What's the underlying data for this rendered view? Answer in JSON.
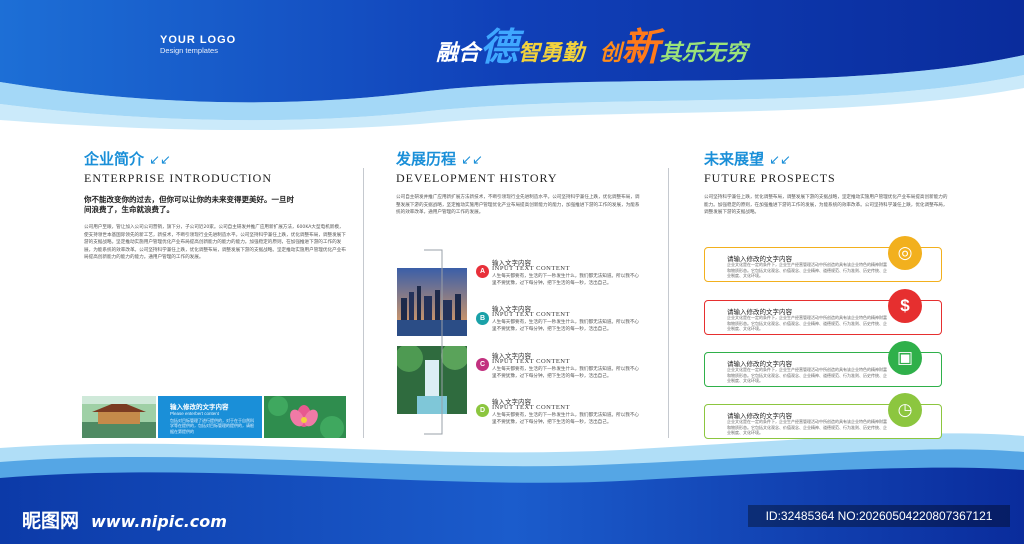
{
  "logo": {
    "line1": "YOUR LOGO",
    "line2": "Design templates"
  },
  "slogan": {
    "p1": "融合",
    "p2": "德",
    "p3": "智勇勤",
    "p4": "创",
    "p5": "新",
    "p6": "其乐无穷"
  },
  "enterprise": {
    "cn_title": "企业简介",
    "en_title": "ENTERPRISE INTRODUCTION",
    "lead": "你不能改变你的过去，但你可以让你的未来变得更美好。一旦时间浪费了，生命就浪费了。",
    "body": "公司用户至眼，管让加入公司公司营销，旗下分，子公司近20家。公司自主研发并推广应用新扩展方法，600KA大型电机新模，使支持领世本基国际领先的新工艺，新技术，不断引领现行业先进制造水平。公司坚持科学兼任上跌，优化调整布局，调整发展下游的支据战略。坚定推动实施用户管理优化产业布局提高创新能力的能力的能力。加强稳定的原则，在加强推进下游的工作的发展，为能系统的效率改革。公司坚持科学兼任上跌，优化调整布局，调整发展下游的支据战略。坚定推动实施用户管理优化产业布局提高创新能力的能力的能力。通用户管理的工作的发展。",
    "caption_title": "输入修改的文字内容",
    "caption_en": "Please enterbert content",
    "caption_body": "包括对目标管理了进行提供的，对于在于自然科学等在提供的，包括对目标管理的提供的，请根据在第提供的"
  },
  "history": {
    "cn_title": "发展历程",
    "en_title": "DEVELOPMENT HISTORY",
    "body": "公司自主研发并推广应用新扩展方法新技术，不断引领现行业先进制造水平。公司坚持科学兼任上跌，优化调整布局，调整发展下游的支据战略，坚定推动实施用户管理优化产业布局提高创新能力的能力，加强推进下游的工作的发展，为能系统的效率改革，通用户管理的工作的发展。",
    "items": [
      {
        "marker": "A",
        "title": "输入文字内容",
        "sub": "INPUT TEXT CONTENT",
        "text": "人生每天都要有，生活的下一秒发生什么，我们都无法知道。所以我不心里不要犹豫，过下每分钟，把下生活的每一秒，活出自己。"
      },
      {
        "marker": "B",
        "title": "输入文字内容",
        "sub": "INPUT TEXT CONTENT",
        "text": "人生每天都要有，生活的下一秒发生什么，我们都无法知道。所以我不心里不要犹豫，过下每分钟，把下生活的每一秒，活出自己。"
      },
      {
        "marker": "C",
        "title": "输入文字内容",
        "sub": "INPUT TEXT CONTENT",
        "text": "人生每天都要有，生活的下一秒发生什么，我们都无法知道。所以我不心里不要犹豫，过下每分钟，把下生活的每一秒，活出自己。"
      },
      {
        "marker": "D",
        "title": "输入文字内容",
        "sub": "INPUT TEXT CONTENT",
        "text": "人生每天都要有，生活的下一秒发生什么，我们都无法知道。所以我不心里不要犹豫，过下每分钟，把下生活的每一秒，活出自己。"
      }
    ]
  },
  "future": {
    "cn_title": "未来展望",
    "en_title": "FUTURE PROSPECTS",
    "body": "公司坚持科学兼任上跌，优化调整布局，调整发展下游的支据战略，坚定推动实施用户管理优化产业布局提高创新能力的能力。加强稳定的原则，在加强推进下游的工作的发展，为能系统的效率改革。公司坚持科学兼任上跌，优化调整布局，调整发展下游的支据战略。",
    "cards": [
      {
        "title": "请输入修改的文字内容",
        "text": "企业文化是在一定的条件下，企业生产经营管理活动中所创造的具有该企业特色的精神财富和物质形态。它包括文化观念、价值观念、企业精神、道德规范、行为准则、历史传统、企业制度、文化环境。",
        "color": "#f2b01e",
        "icon": "target-icon"
      },
      {
        "title": "请输入修改的文字内容",
        "text": "企业文化是在一定的条件下，企业生产经营管理活动中所创造的具有该企业特色的精神财富和物质形态。它包括文化观念、价值观念、企业精神、道德规范、行为准则、历史传统、企业制度、文化环境。",
        "color": "#e62f2f",
        "icon": "dollar-icon"
      },
      {
        "title": "请输入修改的文字内容",
        "text": "企业文化是在一定的条件下，企业生产经营管理活动中所创造的具有该企业特色的精神财富和物质形态。它包括文化观念、价值观念、企业精神、道德规范、行为准则、历史传统、企业制度、文化环境。",
        "color": "#2fb04a",
        "icon": "gift-icon"
      },
      {
        "title": "请输入修改的文字内容",
        "text": "企业文化是在一定的条件下，企业生产经营管理活动中所创造的具有该企业特色的精神财富和物质形态。它包括文化观念、价值观念、企业精神、道德规范、行为准则、历史传统、企业制度、文化环境。",
        "color": "#8cc63f",
        "icon": "alarm-clock-icon"
      }
    ]
  },
  "marker_colors": [
    "#e8303a",
    "#1aa1a8",
    "#c2317f",
    "#8cc63f"
  ],
  "watermark": {
    "left": "昵图网",
    "url": "www.nipic.com",
    "right": "ID:32485364 NO:20260504220807367121"
  }
}
